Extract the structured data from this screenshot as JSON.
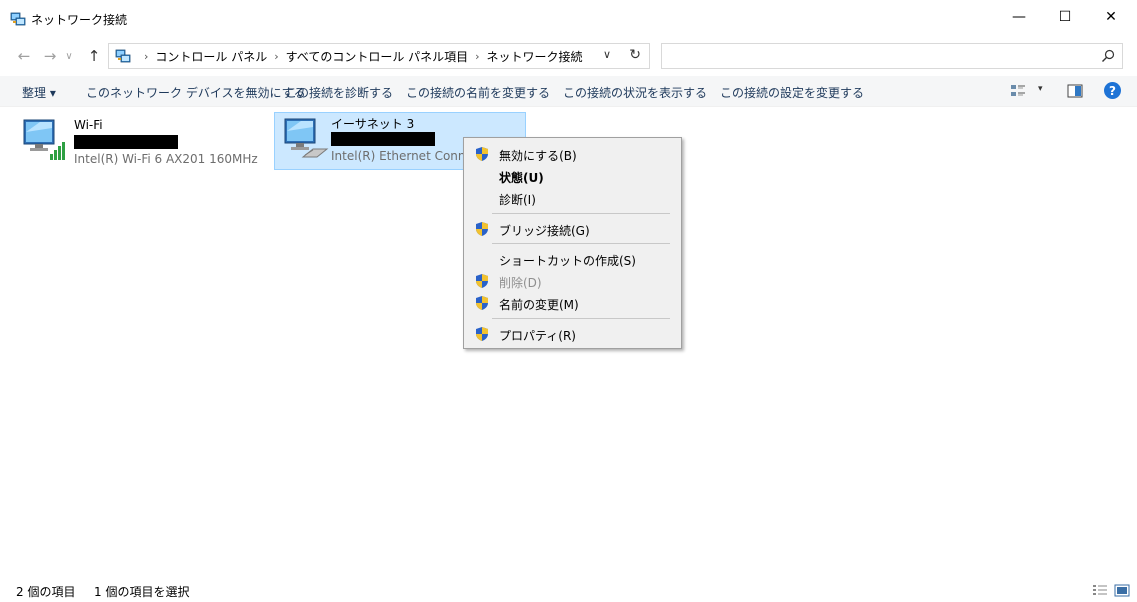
{
  "window": {
    "title": "ネットワーク接続",
    "minimize": "—",
    "maximize": "☐",
    "close": "✕"
  },
  "nav": {
    "back": "←",
    "forward": "→",
    "recent": "∨",
    "up": "↑"
  },
  "address": {
    "crumbs": [
      "コントロール パネル",
      "すべてのコントロール パネル項目",
      "ネットワーク接続"
    ],
    "separator": "›",
    "dropdown": "∨",
    "refresh": "↻",
    "search_placeholder": ""
  },
  "commandbar": {
    "organize": "整理 ▾",
    "disable": "このネットワーク デバイスを無効にする",
    "diagnose": "この接続を診断する",
    "rename": "この接続の名前を変更する",
    "status": "この接続の状況を表示する",
    "settings": "この接続の設定を変更する",
    "view_dropdown": "▾",
    "help": "?"
  },
  "connections": [
    {
      "name": "Wi-Fi",
      "adapter": "Intel(R) Wi-Fi 6 AX201 160MHz"
    },
    {
      "name": "イーサネット 3",
      "adapter": "Intel(R) Ethernet Connect"
    }
  ],
  "context_menu": {
    "items": [
      {
        "label": "無効にする(B)",
        "shield": true,
        "bold": false,
        "disabled": false
      },
      {
        "label": "状態(U)",
        "shield": false,
        "bold": true,
        "disabled": false
      },
      {
        "label": "診断(I)",
        "shield": false,
        "bold": false,
        "disabled": false
      },
      {
        "label": "ブリッジ接続(G)",
        "shield": true,
        "bold": false,
        "disabled": false
      },
      {
        "label": "ショートカットの作成(S)",
        "shield": false,
        "bold": false,
        "disabled": false
      },
      {
        "label": "削除(D)",
        "shield": true,
        "bold": false,
        "disabled": true
      },
      {
        "label": "名前の変更(M)",
        "shield": true,
        "bold": false,
        "disabled": false
      },
      {
        "label": "プロパティ(R)",
        "shield": true,
        "bold": false,
        "disabled": false
      }
    ]
  },
  "statusbar": {
    "count": "2 個の項目",
    "selected": "1 個の項目を選択"
  }
}
